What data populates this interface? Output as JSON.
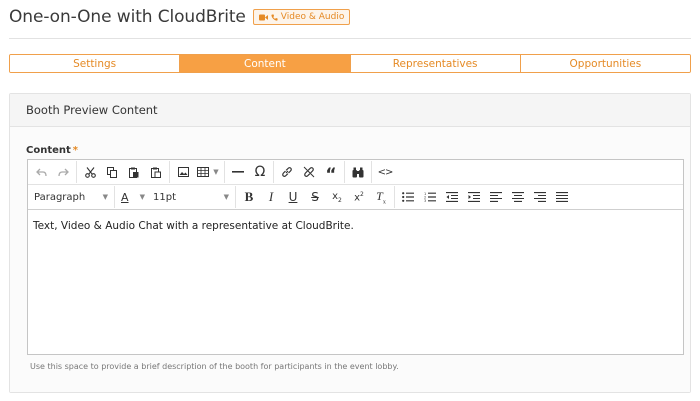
{
  "header": {
    "title": "One-on-One with CloudBrite",
    "badge": {
      "icon": "video-camera-icon",
      "sub_icon": "phone-icon",
      "label": "Video & Audio",
      "color": "#e58a25"
    }
  },
  "tabs": [
    {
      "label": "Settings",
      "active": false
    },
    {
      "label": "Content",
      "active": true
    },
    {
      "label": "Representatives",
      "active": false
    },
    {
      "label": "Opportunities",
      "active": false
    }
  ],
  "panel": {
    "title": "Booth Preview Content",
    "field_label": "Content",
    "required_mark": "*",
    "editor": {
      "format_select": "Paragraph",
      "font_color_label": "A",
      "font_size_select": "11pt",
      "content": "Text, Video & Audio Chat with a representative at CloudBrite."
    },
    "help_text": "Use this space to provide a brief description of the booth for participants in the event lobby."
  },
  "colors": {
    "accent": "#f7a044",
    "accent_text": "#e58a25",
    "border": "#e3e3e3"
  }
}
